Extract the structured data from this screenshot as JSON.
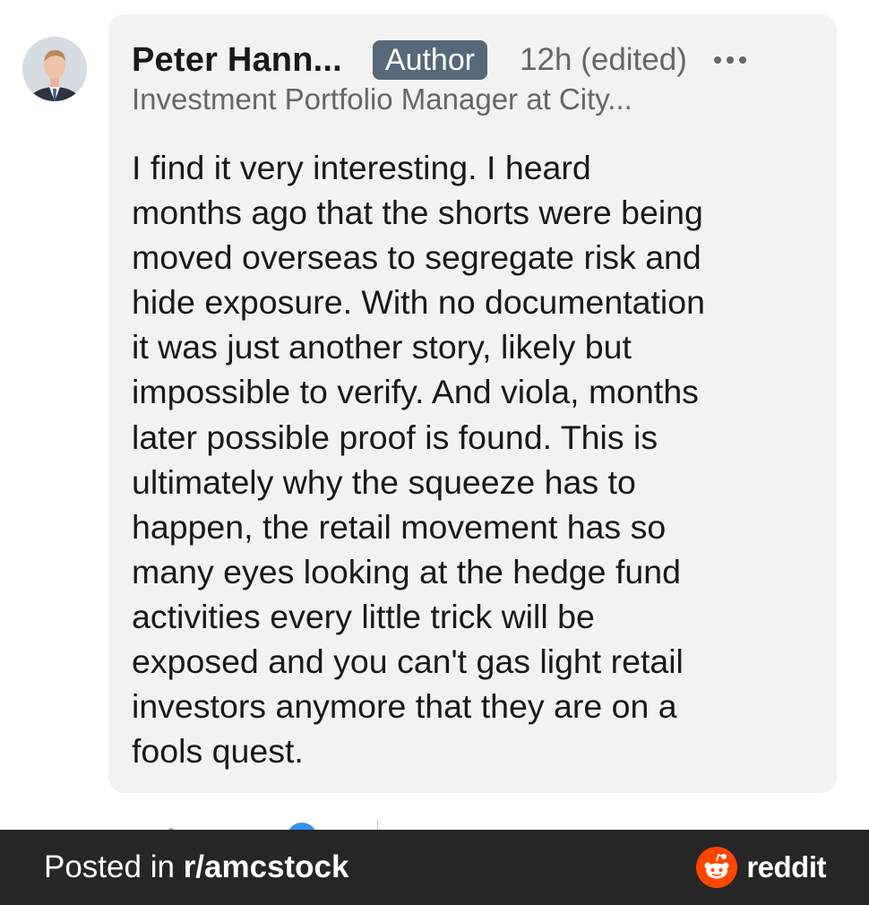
{
  "comment": {
    "author_name": "Peter Hann...",
    "author_badge": "Author",
    "timestamp": "12h (edited)",
    "headline": "Investment Portfolio Manager at City...",
    "body": "I find it very interesting. I heard\nmonths ago that the shorts were being\nmoved overseas to segregate risk and\nhide exposure. With no documentation\nit was just another story, likely but\nimpossible to verify. And viola, months\nlater possible proof is found. This is\nultimately why the squeeze has to\nhappen, the retail movement has so\nmany eyes looking at the hedge fund\nactivities every little trick will be\nexposed and you can't gas light retail\ninvestors anymore that they are on a\nfools quest.",
    "more_icon": "more-horizontal-icon",
    "badge_color": "#56687a",
    "bubble_color": "#f2f2f2"
  },
  "footer": {
    "prefix": "Posted in ",
    "subreddit": "r/amcstock",
    "brand": "reddit",
    "brand_color": "#ff4500",
    "background": "#262626"
  }
}
